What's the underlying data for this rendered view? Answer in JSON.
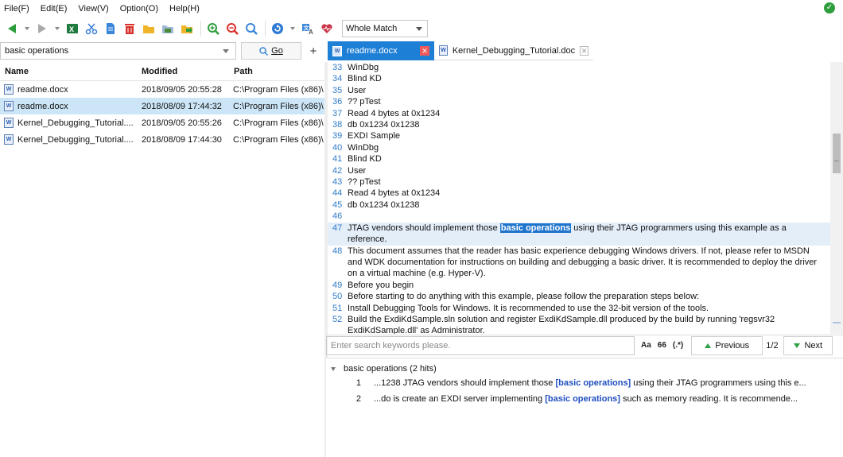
{
  "menu": [
    "File(F)",
    "Edit(E)",
    "View(V)",
    "Option(O)",
    "Help(H)"
  ],
  "toolbar": {
    "match_mode": "Whole Match",
    "icons": [
      "back-icon",
      "forward-icon",
      "excel-icon",
      "cut-icon",
      "file-icon",
      "delete-icon",
      "folder-icon",
      "folder-open-icon",
      "export-icon",
      "zoom-in-icon",
      "zoom-out-icon",
      "zoom-reset-icon",
      "refresh-icon",
      "translate-icon",
      "heart-icon"
    ]
  },
  "search": {
    "query": "basic operations",
    "go_label": "Go",
    "add_label": "+"
  },
  "tabs": [
    {
      "label": "readme.docx",
      "active": true
    },
    {
      "label": "Kernel_Debugging_Tutorial.doc",
      "active": false
    }
  ],
  "filelist": {
    "columns": [
      "Name",
      "Modified",
      "Path"
    ],
    "rows": [
      {
        "name": "readme.docx",
        "modified": "2018/09/05 20:55:28",
        "path": "C:\\Program Files (x86)\\",
        "selected": false
      },
      {
        "name": "readme.docx",
        "modified": "2018/08/09 17:44:32",
        "path": "C:\\Program Files (x86)\\",
        "selected": true
      },
      {
        "name": "Kernel_Debugging_Tutorial....",
        "modified": "2018/09/05 20:55:26",
        "path": "C:\\Program Files (x86)\\",
        "selected": false
      },
      {
        "name": "Kernel_Debugging_Tutorial....",
        "modified": "2018/08/09 17:44:30",
        "path": "C:\\Program Files (x86)\\",
        "selected": false
      }
    ]
  },
  "document": {
    "lines": [
      {
        "n": "33",
        "t": "WinDbg"
      },
      {
        "n": "34",
        "t": "Blind KD"
      },
      {
        "n": "35",
        "t": "User"
      },
      {
        "n": "36",
        "t": "?? pTest"
      },
      {
        "n": "37",
        "t": "Read 4 bytes at 0x1234"
      },
      {
        "n": "38",
        "t": "db 0x1234 0x1238"
      },
      {
        "n": "39",
        "t": "EXDI Sample"
      },
      {
        "n": "40",
        "t": "WinDbg"
      },
      {
        "n": "41",
        "t": "Blind KD"
      },
      {
        "n": "42",
        "t": "User"
      },
      {
        "n": "43",
        "t": "?? pTest"
      },
      {
        "n": "44",
        "t": "Read 4 bytes at 0x1234"
      },
      {
        "n": "45",
        "t": "db 0x1234 0x1238"
      },
      {
        "n": "46",
        "t": ""
      }
    ],
    "hit_line": {
      "n": "47",
      "before": "JTAG vendors should implement those ",
      "hit": "basic operations",
      "after": " using their JTAG programmers using this example as a reference."
    },
    "after_lines": [
      {
        "n": "48",
        "t": "This document assumes that the reader has basic experience debugging Windows drivers. If not, please refer to MSDN and WDK documentation for instructions on building and debugging a basic driver. It is recommended to deploy the driver on a virtual machine (e.g. Hyper-V)."
      },
      {
        "n": "49",
        "t": "Before you begin"
      },
      {
        "n": "50",
        "t": "Before starting to do anything with this example, please follow the preparation steps below:"
      },
      {
        "n": "51",
        "t": "Install Debugging Tools for Windows. It is recommended to use the 32-bit version of the tools."
      },
      {
        "n": "52",
        "t": "Build the ExdiKdSample.sln solution and register ExdiKdSample.dll produced by the build by running 'regsvr32 ExdiKdSample.dll' as Administrator."
      }
    ]
  },
  "findbar": {
    "placeholder": "Enter search keywords please.",
    "opt_case": "Aa",
    "opt_quote": "66",
    "opt_regex": "(.*)",
    "prev_label": "Previous",
    "counter": "1/2",
    "next_label": "Next"
  },
  "results": {
    "header": "basic operations (2 hits)",
    "items": [
      {
        "num": "1",
        "before": "...1238 JTAG vendors should implement those ",
        "kw": "[basic operations]",
        "after": " using their JTAG programmers using this e..."
      },
      {
        "num": "2",
        "before": "...do is create an EXDI server implementing ",
        "kw": "[basic operations]",
        "after": " such as memory reading. It is recommende..."
      }
    ]
  }
}
